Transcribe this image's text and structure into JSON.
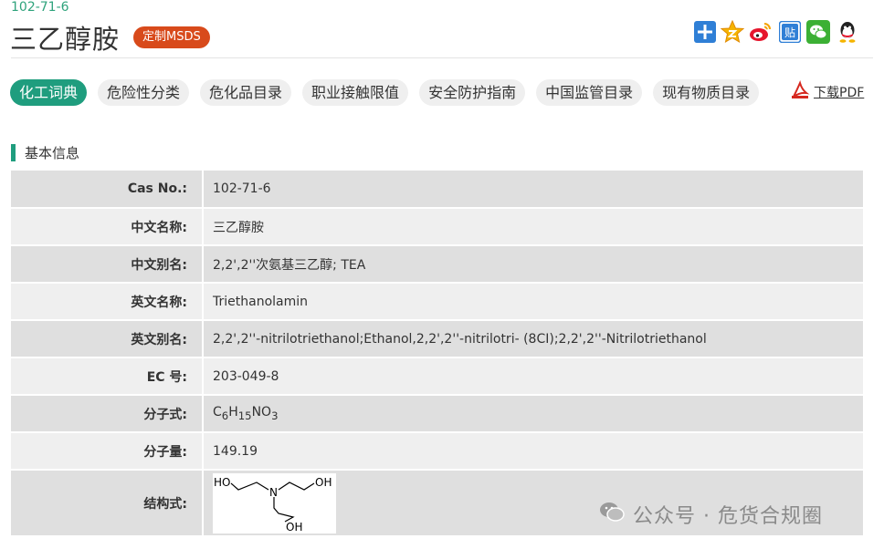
{
  "header": {
    "cas_number": "102-71-6",
    "title": "三乙醇胺",
    "msds_button": "定制MSDS",
    "share_icons": [
      "add-share-icon",
      "qzone-icon",
      "weibo-icon",
      "tieba-icon",
      "wechat-icon",
      "qq-icon"
    ],
    "tieba_glyph": "贴"
  },
  "tabs": [
    {
      "label": "化工词典",
      "active": true
    },
    {
      "label": "危险性分类",
      "active": false
    },
    {
      "label": "危化品目录",
      "active": false
    },
    {
      "label": "职业接触限值",
      "active": false
    },
    {
      "label": "安全防护指南",
      "active": false
    },
    {
      "label": "中国监管目录",
      "active": false
    },
    {
      "label": "现有物质目录",
      "active": false
    }
  ],
  "download_pdf": "下载PDF",
  "section": {
    "title": "基本信息"
  },
  "info": {
    "cas": {
      "label": "Cas No.:",
      "value": "102-71-6"
    },
    "cn_name": {
      "label": "中文名称:",
      "value": "三乙醇胺"
    },
    "cn_alias": {
      "label": "中文别名:",
      "value": "2,2',2''次氨基三乙醇; TEA"
    },
    "en_name": {
      "label": "英文名称:",
      "value": "Triethanolamin"
    },
    "en_alias": {
      "label": "英文别名:",
      "value": "2,2',2''-nitrilotriethanol;Ethanol,2,2',2''-nitrilotri- (8CI);2,2',2''-Nitrilotriethanol"
    },
    "ec": {
      "label": "EC 号:",
      "value": "203-049-8"
    },
    "formula": {
      "label": "分子式:",
      "parts": {
        "c": "C",
        "c_n": "6",
        "h": "H",
        "h_n": "15",
        "no": "NO",
        "o_n": "3"
      }
    },
    "weight": {
      "label": "分子量:",
      "value": "149.19"
    },
    "structure": {
      "label": "结构式:",
      "atoms": {
        "n": "N",
        "oh": "HO",
        "oh2": "OH",
        "oh3": "OH"
      }
    }
  },
  "colors": {
    "accent": "#1f9d7e",
    "msds": "#d84a1b",
    "row_dark": "#dfdfdf",
    "row_light": "#efefef"
  },
  "watermark": "公众号 · 危货合规圈"
}
